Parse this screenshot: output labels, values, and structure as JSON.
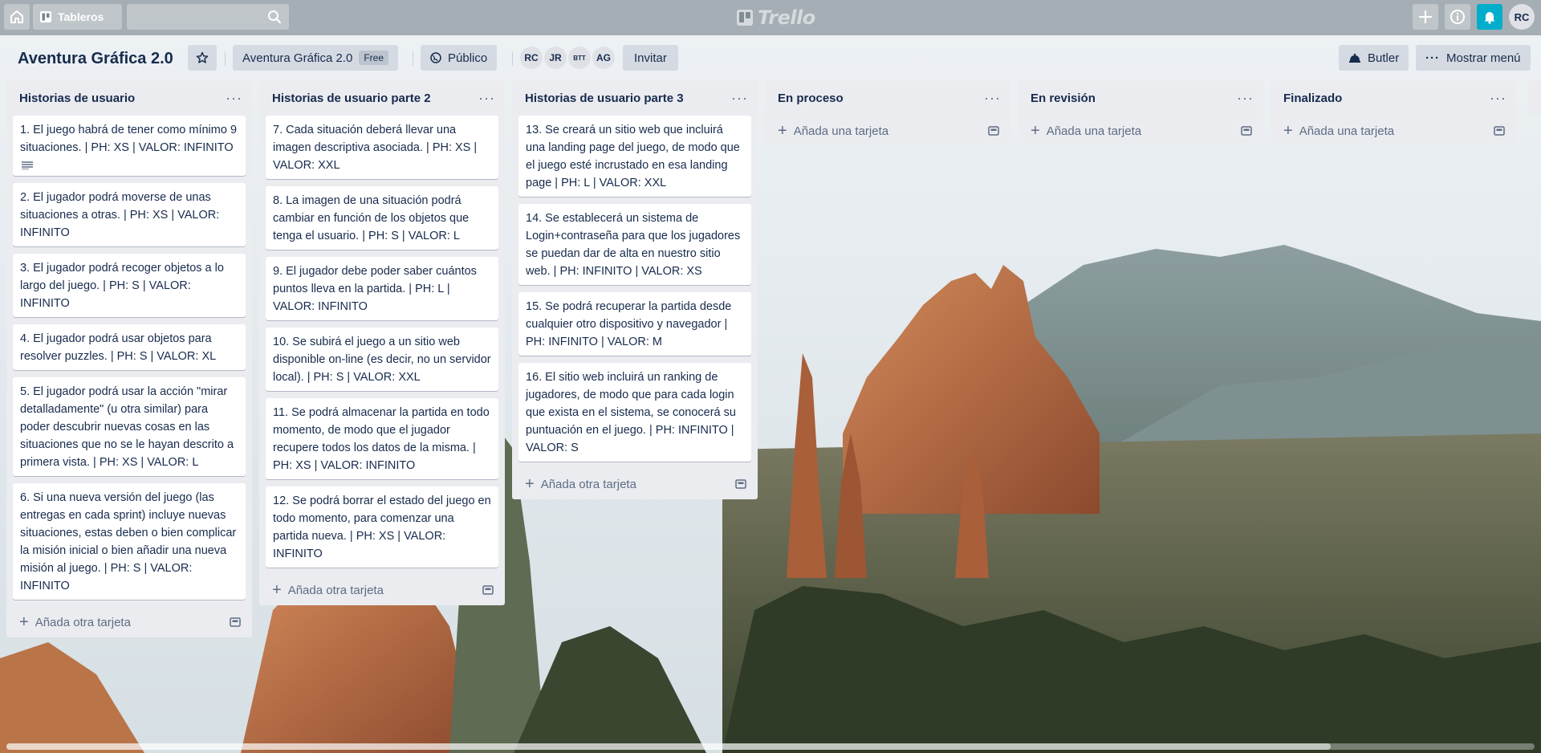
{
  "header": {
    "boards_label": "Tableros",
    "search_placeholder": "",
    "logo_text": "Trello",
    "user_initials": "RC"
  },
  "board": {
    "title": "Aventura Gráfica 2.0",
    "team_name": "Aventura Gráfica 2.0",
    "plan_badge": "Free",
    "visibility_label": "Público",
    "members": [
      "RC",
      "JR",
      "BTT",
      "AG"
    ],
    "invite_label": "Invitar",
    "butler_label": "Butler",
    "menu_label": "Mostrar menú"
  },
  "lists": [
    {
      "title": "Historias de usuario",
      "cards": [
        "1. El juego habrá de tener como mínimo 9 situaciones. | PH: XS | VALOR: INFINITO",
        "2. El jugador podrá moverse de unas situaciones a otras. | PH: XS | VALOR: INFINITO",
        "3. El jugador podrá recoger objetos a lo largo del juego. | PH: S | VALOR: INFINITO",
        "4. El jugador podrá usar objetos para resolver puzzles. | PH: S | VALOR: XL",
        "5. El jugador podrá usar la acción \"mirar detalladamente\" (u otra similar) para poder descubrir nuevas cosas en las situaciones que no se le hayan descrito a primera vista. | PH: XS | VALOR: L",
        "6. Si una nueva versión del juego (las entregas en cada sprint) incluye nuevas situaciones, estas deben o bien complicar la misión inicial o bien añadir una nueva misión al juego. | PH: S | VALOR: INFINITO"
      ],
      "add_label": "Añada otra tarjeta"
    },
    {
      "title": "Historias de usuario parte 2",
      "cards": [
        "7. Cada situación deberá llevar una imagen descriptiva asociada. | PH: XS | VALOR: XXL",
        "8. La imagen de una situación podrá cambiar en función de los objetos que tenga el usuario. | PH: S | VALOR: L",
        "9. El jugador debe poder saber cuántos puntos lleva en la partida. | PH: L | VALOR: INFINITO",
        "10. Se subirá el juego a un sitio web disponible on-line (es decir, no un servidor local). | PH: S | VALOR: XXL",
        "11. Se podrá almacenar la partida en todo momento, de modo que el jugador recupere todos los datos de la misma. | PH: XS | VALOR: INFINITO",
        "12. Se podrá borrar el estado del juego en todo momento, para comenzar una partida nueva. | PH: XS | VALOR: INFINITO"
      ],
      "add_label": "Añada otra tarjeta"
    },
    {
      "title": "Historias de usuario parte 3",
      "cards": [
        "13. Se creará un sitio web que incluirá una landing page del juego, de modo que el juego esté incrustado en esa landing page | PH: L | VALOR: XXL",
        "14. Se establecerá un sistema de Login+contraseña para que los jugadores se puedan dar de alta en nuestro sitio web. | PH: INFINITO | VALOR: XS",
        "15. Se podrá recuperar la partida desde cualquier otro dispositivo y navegador | PH: INFINITO | VALOR: M",
        "16. El sitio web incluirá un ranking de jugadores, de modo que para cada login que exista en el sistema, se conocerá su puntuación en el juego. | PH: INFINITO | VALOR: S"
      ],
      "add_label": "Añada otra tarjeta"
    },
    {
      "title": "En proceso",
      "cards": [],
      "add_label": "Añada una tarjeta"
    },
    {
      "title": "En revisión",
      "cards": [],
      "add_label": "Añada una tarjeta"
    },
    {
      "title": "Finalizado",
      "cards": [],
      "add_label": "Añada una tarjeta"
    }
  ]
}
